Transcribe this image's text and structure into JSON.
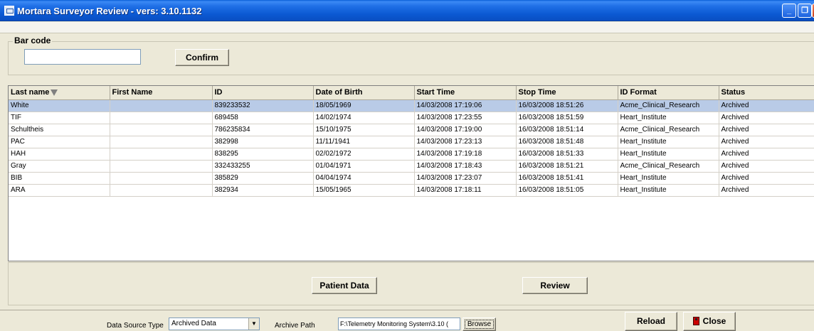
{
  "window": {
    "title": "Mortara Surveyor Review - vers: 3.10.1132",
    "minimize_glyph": "_",
    "maximize_glyph": "❐",
    "close_glyph": "✕"
  },
  "barcode": {
    "legend": "Bar code",
    "value": "",
    "confirm_label": "Confirm"
  },
  "table": {
    "columns": [
      "Last name",
      "First Name",
      "ID",
      "Date of Birth",
      "Start Time",
      "Stop Time",
      "ID Format",
      "Status"
    ],
    "sorted_column": "Last name",
    "rows": [
      {
        "last_name": "White",
        "first_name": "",
        "id": "839233532",
        "dob": "18/05/1969",
        "start": "14/03/2008 17:19:06",
        "stop": "16/03/2008 18:51:26",
        "format": "Acme_Clinical_Research",
        "status": "Archived",
        "selected": true
      },
      {
        "last_name": "TIF",
        "first_name": "",
        "id": "689458",
        "dob": "14/02/1974",
        "start": "14/03/2008 17:23:55",
        "stop": "16/03/2008 18:51:59",
        "format": "Heart_Institute",
        "status": "Archived"
      },
      {
        "last_name": "Schultheis",
        "first_name": "",
        "id": "786235834",
        "dob": "15/10/1975",
        "start": "14/03/2008 17:19:00",
        "stop": "16/03/2008 18:51:14",
        "format": "Acme_Clinical_Research",
        "status": "Archived"
      },
      {
        "last_name": "PAC",
        "first_name": "",
        "id": "382998",
        "dob": "11/11/1941",
        "start": "14/03/2008 17:23:13",
        "stop": "16/03/2008 18:51:48",
        "format": "Heart_Institute",
        "status": "Archived"
      },
      {
        "last_name": "HAH",
        "first_name": "",
        "id": "838295",
        "dob": "02/02/1972",
        "start": "14/03/2008 17:19:18",
        "stop": "16/03/2008 18:51:33",
        "format": "Heart_Institute",
        "status": "Archived"
      },
      {
        "last_name": "Gray",
        "first_name": "",
        "id": "332433255",
        "dob": "01/04/1971",
        "start": "14/03/2008 17:18:43",
        "stop": "16/03/2008 18:51:21",
        "format": "Acme_Clinical_Research",
        "status": "Archived"
      },
      {
        "last_name": "BIB",
        "first_name": "",
        "id": "385829",
        "dob": "04/04/1974",
        "start": "14/03/2008 17:23:07",
        "stop": "16/03/2008 18:51:41",
        "format": "Heart_Institute",
        "status": "Archived"
      },
      {
        "last_name": "ARA",
        "first_name": "",
        "id": "382934",
        "dob": "15/05/1965",
        "start": "14/03/2008 17:18:11",
        "stop": "16/03/2008 18:51:05",
        "format": "Heart_Institute",
        "status": "Archived"
      }
    ]
  },
  "actions": {
    "patient_data_label": "Patient Data",
    "review_label": "Review"
  },
  "statusbar": {
    "data_source_label": "Data Source Type",
    "data_source_value": "Archived Data",
    "archive_path_label": "Archive Path",
    "archive_path_value": "F:\\Telemetry Monitoring System\\3.10 (",
    "browse_label": "Browse",
    "reload_label": "Reload",
    "close_label": "Close"
  },
  "colors": {
    "titlebar": "#0b58d2",
    "selected_row": "#b9cbe7",
    "window_bg": "#ece9d8"
  }
}
